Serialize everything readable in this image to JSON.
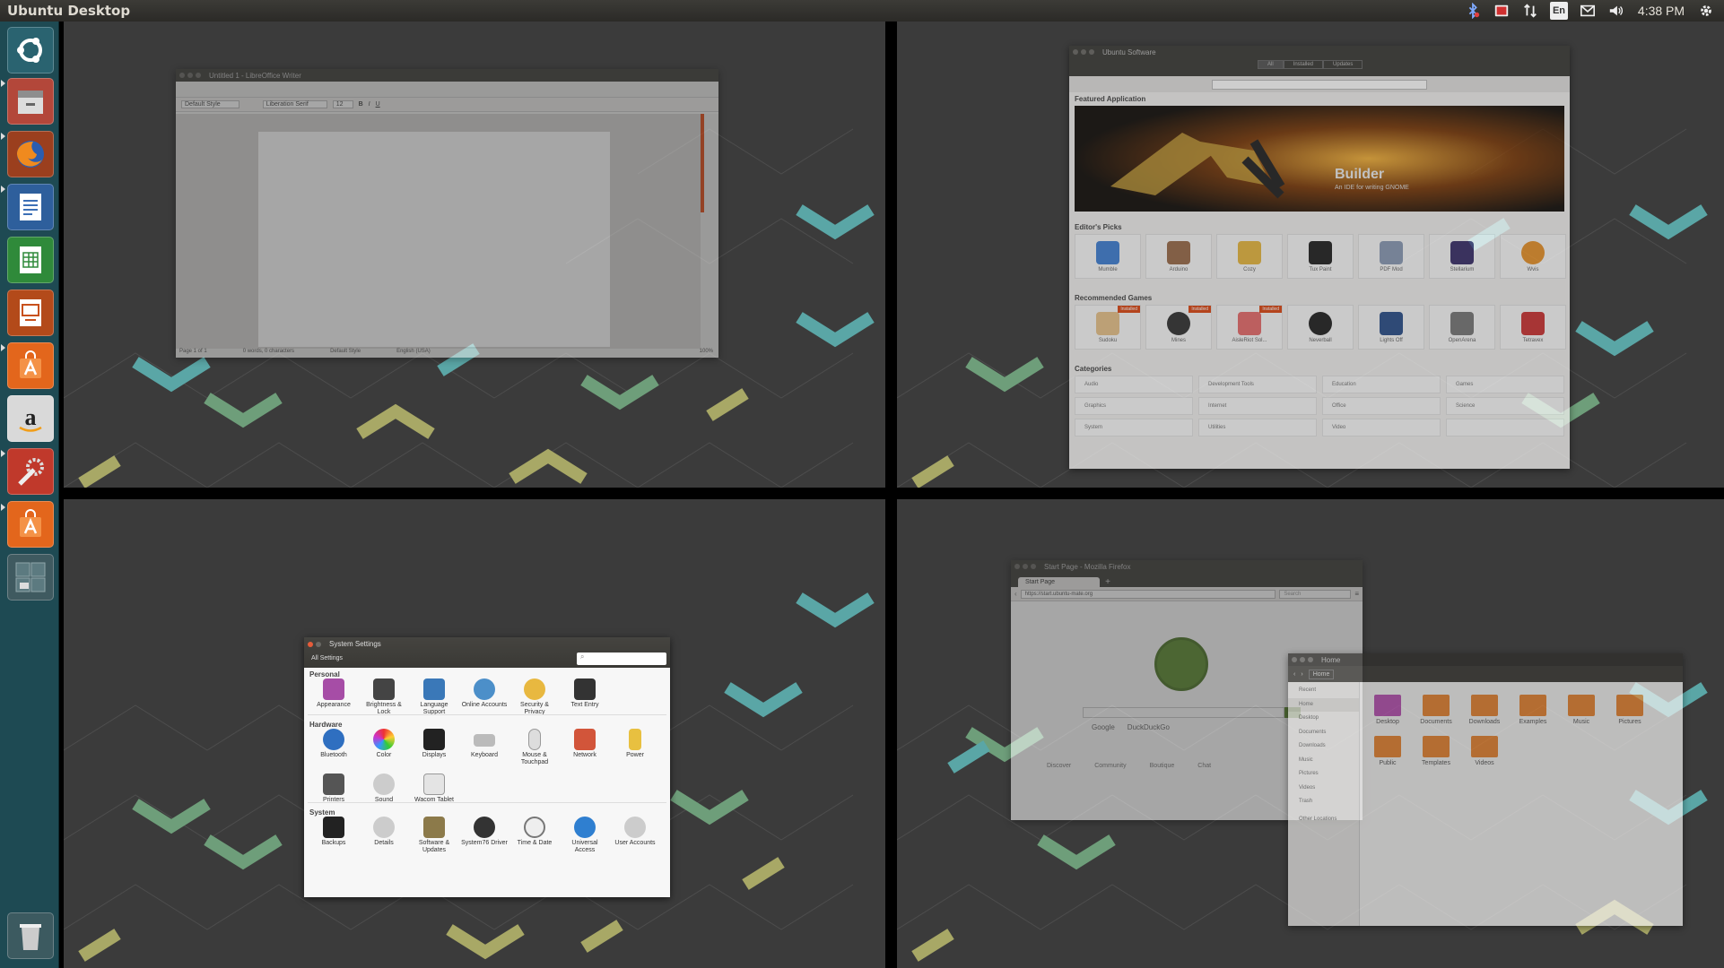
{
  "topbar": {
    "title": "Ubuntu Desktop",
    "keyboard": "En",
    "clock": "4:38 PM",
    "icons": [
      "bluetooth-icon",
      "record-icon",
      "network-icon",
      "keyboard-icon",
      "mail-icon",
      "volume-icon",
      "gear-icon"
    ]
  },
  "launcher": {
    "items": [
      {
        "name": "dash-home",
        "icon": "ubuntu-logo-icon"
      },
      {
        "name": "files",
        "icon": "file-cabinet-icon"
      },
      {
        "name": "firefox",
        "icon": "firefox-icon"
      },
      {
        "name": "writer",
        "icon": "libreoffice-writer-icon"
      },
      {
        "name": "calc",
        "icon": "libreoffice-calc-icon"
      },
      {
        "name": "impress",
        "icon": "libreoffice-impress-icon"
      },
      {
        "name": "software-center",
        "icon": "shopping-bag-icon"
      },
      {
        "name": "amazon",
        "icon": "amazon-icon"
      },
      {
        "name": "system-settings",
        "icon": "wrench-gear-icon"
      },
      {
        "name": "software-updater",
        "icon": "shopping-bag-icon"
      },
      {
        "name": "workspace-switcher",
        "icon": "workspaces-icon"
      },
      {
        "name": "trash",
        "icon": "trash-icon"
      }
    ]
  },
  "colors": {
    "accent": "#dd4814",
    "launcher_bg": "#1e4a53",
    "wallpaper": "#3b3b3b",
    "hex_teal": "#5aa6a6",
    "hex_green": "#6e9e7a",
    "hex_olive": "#a8a866"
  },
  "writer": {
    "title": "Untitled 1 - LibreOffice Writer",
    "style": "Default Style",
    "font": "Liberation Serif",
    "size": "12",
    "status_page": "Page 1 of 1",
    "status_words": "0 words, 0 characters",
    "status_style": "Default Style",
    "status_lang": "English (USA)",
    "status_zoom": "100%"
  },
  "software": {
    "title": "Ubuntu Software",
    "tabs": [
      "All",
      "Installed",
      "Updates"
    ],
    "featured_heading": "Featured Application",
    "featured_name": "Builder",
    "featured_tagline": "An IDE for writing GNOME",
    "editors_heading": "Editor's Picks",
    "editors": [
      "Mumble",
      "Arduino",
      "Cozy",
      "Tux Paint",
      "PDF Mod",
      "Stellarium",
      "Wvis"
    ],
    "games_heading": "Recommended Games",
    "games": [
      "Sudoku",
      "Mines",
      "AisleRiot Sol...",
      "Neverball",
      "Lights Off",
      "OpenArena",
      "Tetravex"
    ],
    "installed_badge": "Installed",
    "categories_heading": "Categories",
    "categories": [
      "Audio",
      "Development Tools",
      "Education",
      "Games",
      "Graphics",
      "Internet",
      "Office",
      "Science",
      "System",
      "Utilities",
      "Video",
      ""
    ]
  },
  "settings": {
    "title": "System Settings",
    "all_settings": "All Settings",
    "personal_heading": "Personal",
    "personal": [
      "Appearance",
      "Brightness & Lock",
      "Language Support",
      "Online Accounts",
      "Security & Privacy",
      "Text Entry"
    ],
    "hardware_heading": "Hardware",
    "hardware": [
      "Bluetooth",
      "Color",
      "Displays",
      "Keyboard",
      "Mouse & Touchpad",
      "Network",
      "Power",
      "Printers",
      "Sound",
      "Wacom Tablet"
    ],
    "system_heading": "System",
    "system": [
      "Backups",
      "Details",
      "Software & Updates",
      "Time & Date",
      "Universal Access",
      "User Accounts",
      "System76 Driver"
    ]
  },
  "firefox": {
    "title": "Start Page - Mozilla Firefox",
    "tab": "Start Page",
    "url": "https://start.ubuntu-mate.org",
    "search_placeholder": "Search",
    "google": "Google",
    "ddg": "DuckDuckGo",
    "links": [
      "Discover",
      "Community",
      "Boutique",
      "Chat"
    ]
  },
  "files": {
    "title": "Home",
    "path": "Home",
    "sidebar": [
      "Recent",
      "Home",
      "Desktop",
      "Documents",
      "Downloads",
      "Music",
      "Pictures",
      "Videos",
      "Trash",
      "Other Locations"
    ],
    "folders": [
      "Desktop",
      "Documents",
      "Downloads",
      "Examples",
      "Music",
      "Pictures",
      "Public",
      "Templates",
      "Videos"
    ]
  }
}
